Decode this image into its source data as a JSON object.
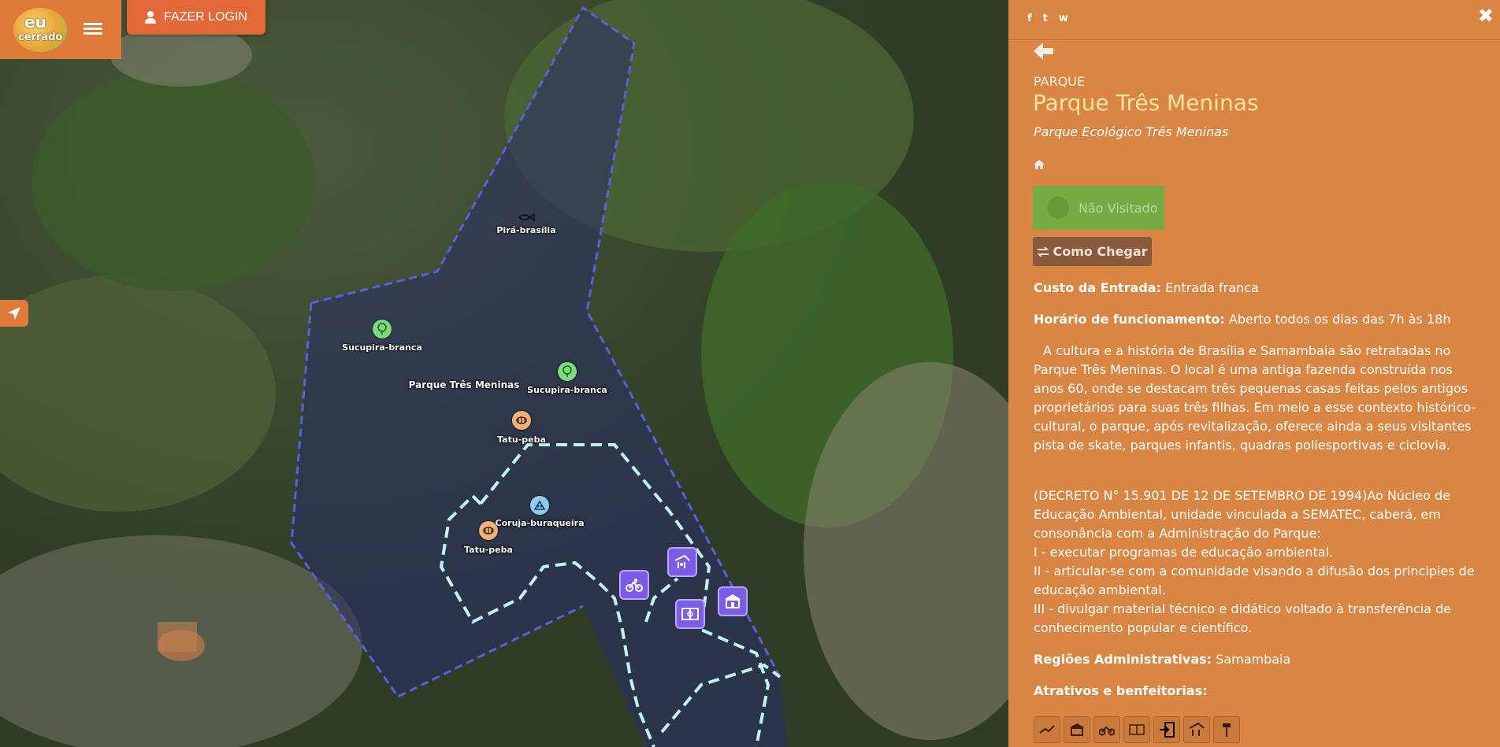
{
  "header": {
    "logo_line1": "eu",
    "logo_line2": "cerrado",
    "login_label": "FAZER LOGIN"
  },
  "icons": {
    "menu": "hamburger-icon",
    "user": "user-icon",
    "locate": "location-arrow-icon",
    "facebook": "facebook-icon",
    "twitter": "twitter-icon",
    "whatsapp": "whatsapp-icon",
    "close": "close-icon",
    "back": "arrow-left-icon",
    "home": "home-icon",
    "route": "exchange-icon"
  },
  "map": {
    "labels": {
      "pira": "Pirá-brasília",
      "sucupira1": "Sucupira-branca",
      "sucupira2": "Sucupira-branca",
      "park": "Parque Três Meninas",
      "tatu1": "Tatu-peba",
      "coruja": "Coruja-buraqueira",
      "tatu2": "Tatu-peba"
    },
    "colors": {
      "park_boundary": "#5a5ee0",
      "trail": "#bff3f5",
      "tree_marker": "#7ddc7a",
      "animal_marker": "#f0b27a",
      "bird_marker": "#8ecdf0",
      "amenity": "#7a5ce6"
    }
  },
  "panel": {
    "share": {
      "facebook": "f",
      "twitter": "t",
      "whatsapp": "w"
    },
    "close": "✖",
    "category": "PARQUE",
    "title": "Parque Três Meninas",
    "subtitle": "Parque Ecológico Três Meninas",
    "visit_label": "Não Visitado",
    "route_label": "Como Chegar",
    "entry_label": "Custo da Entrada:",
    "entry_value": " Entrada franca",
    "hours_label": "Horário de funcionamento:",
    "hours_value": " Aberto todos os dias das 7h às 18h",
    "description": "A cultura e a história de Brasília e Samambaia são retratadas no Parque Três Meninas. O local é uma antiga fazenda construída nos anos 60, onde se destacam três pequenas casas feitas pelos antigos proprietários para suas três filhas. Em meio a esse contexto histórico-cultural, o parque, após revitalização, oferece ainda a seus visitantes pista de skate, parques infantis, quadras poliesportivas e ciclovia.",
    "decree_lines": [
      "(DECRETO N° 15.901 DE 12 DE SETEMBRO DE 1994)Ao Núcleo de Educação Ambiental, unidade vinculada a SEMATEC, caberá, em consonância com a Administração do Parque:",
      "I - executar programas de educação ambiental.",
      "II - articular-se com a comunidade visando a difusão dos principies de educação ambiental.",
      "III - divulgar material técnico e didático voltado à transferência de conhecimento popular e científico."
    ],
    "regions_label": "Regiões Administrativas:",
    "regions_value": " Samambaia",
    "attractions_label": "Atrativos e benfeitorias:",
    "attraction_icons": [
      "skate-icon",
      "museum-icon",
      "bike-icon",
      "court-icon",
      "entrance-icon",
      "playground-icon",
      "fitness-icon"
    ]
  }
}
